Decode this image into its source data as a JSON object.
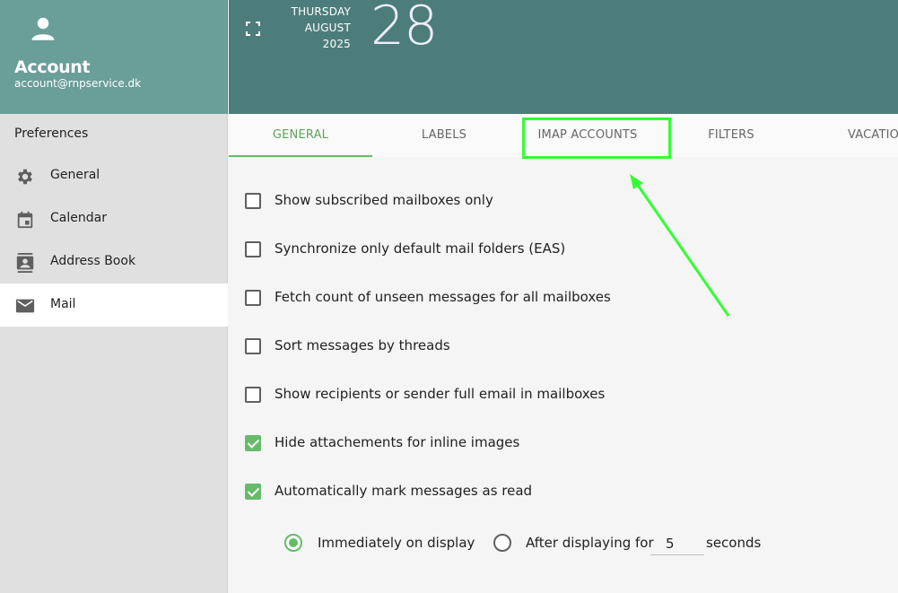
{
  "account": {
    "name": "Account",
    "email": "account@rnpservice.dk",
    "avatar_icon": "person-icon"
  },
  "banner": {
    "weekday": "THURSDAY",
    "month": "AUGUST",
    "year": "2025",
    "day": "28",
    "fullscreen_icon": "fullscreen-icon"
  },
  "sidebar": {
    "title": "Preferences",
    "items": [
      {
        "label": "General",
        "icon": "gear-icon",
        "active": false
      },
      {
        "label": "Calendar",
        "icon": "calendar-icon",
        "active": false
      },
      {
        "label": "Address Book",
        "icon": "contacts-icon",
        "active": false
      },
      {
        "label": "Mail",
        "icon": "mail-icon",
        "active": true
      }
    ]
  },
  "tabs": [
    {
      "label": "GENERAL",
      "active": true
    },
    {
      "label": "LABELS",
      "active": false
    },
    {
      "label": "IMAP ACCOUNTS",
      "active": false
    },
    {
      "label": "FILTERS",
      "active": false
    },
    {
      "label": "VACATION",
      "active": false
    }
  ],
  "options": [
    {
      "label": "Show subscribed mailboxes only",
      "checked": false
    },
    {
      "label": "Synchronize only default mail folders (EAS)",
      "checked": false
    },
    {
      "label": "Fetch count of unseen messages for all mailboxes",
      "checked": false
    },
    {
      "label": "Sort messages by threads",
      "checked": false
    },
    {
      "label": "Show recipients or sender full email in mailboxes",
      "checked": false
    },
    {
      "label": "Hide attachements for inline images",
      "checked": true
    },
    {
      "label": "Automatically mark messages as read",
      "checked": true
    }
  ],
  "mark_read": {
    "immediately_label": "Immediately on display",
    "after_label": "After displaying for",
    "seconds_value": "5",
    "seconds_label": "seconds",
    "selected": "immediately"
  },
  "colors": {
    "accent": "#66bb6a",
    "header": "#6a9e98",
    "banner": "#4d7d7a",
    "highlight": "#33ff33"
  }
}
